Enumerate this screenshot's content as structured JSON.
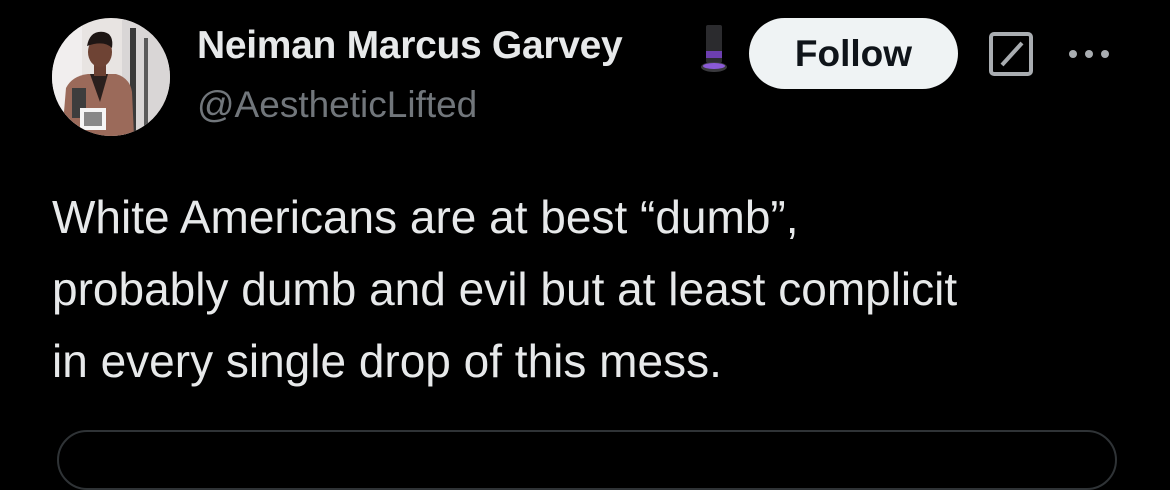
{
  "author": {
    "display_name": "Neiman Marcus Garvey",
    "handle": "@AestheticLifted",
    "avatar_icon": "avatar",
    "badge_icon": "top-hat-icon"
  },
  "actions": {
    "follow_label": "Follow",
    "grok_icon": "grok-icon",
    "more_icon": "more-options-icon"
  },
  "tweet": {
    "lines": [
      "White Americans are at best “dumb”,",
      "probably dumb and evil but at least complicit",
      "in every single drop of this mess."
    ]
  },
  "colors": {
    "background": "#000000",
    "primary_text": "#e7e9ea",
    "secondary_text": "#71767b",
    "follow_bg": "#eff3f4",
    "follow_text": "#0f1419",
    "border": "#2f3336"
  }
}
